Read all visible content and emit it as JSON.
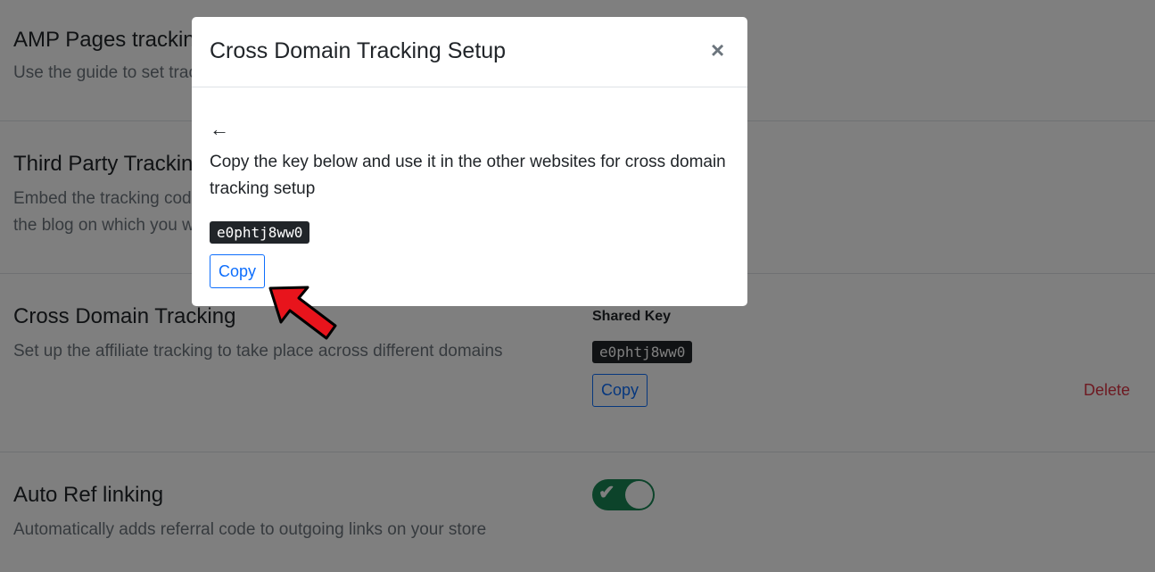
{
  "sections": [
    {
      "title": "AMP Pages tracking",
      "description": "Use the guide to set tracking"
    },
    {
      "title": "Third Party Tracking",
      "description": "Embed the tracking code in the blog on which you want"
    },
    {
      "title": "Cross Domain Tracking",
      "description": "Set up the affiliate tracking to take place across different domains"
    },
    {
      "title": "Auto Ref linking",
      "description": "Automatically adds referral code to outgoing links on your store"
    }
  ],
  "cross_domain": {
    "shared_key_label": "Shared Key",
    "key_value": "e0phtj8ww0",
    "copy_label": "Copy",
    "delete_label": "Delete"
  },
  "auto_ref": {
    "toggle_on": true,
    "check_glyph": "✔"
  },
  "modal": {
    "title": "Cross Domain Tracking Setup",
    "close_glyph": "×",
    "back_glyph": "←",
    "instructions": "Copy the key below and use it in the other websites for cross domain tracking setup",
    "key_value": "e0phtj8ww0",
    "copy_label": "Copy"
  },
  "colors": {
    "primary": "#0d6efd",
    "danger": "#dc3545",
    "success": "#198754",
    "arrow": "#e8141c"
  }
}
